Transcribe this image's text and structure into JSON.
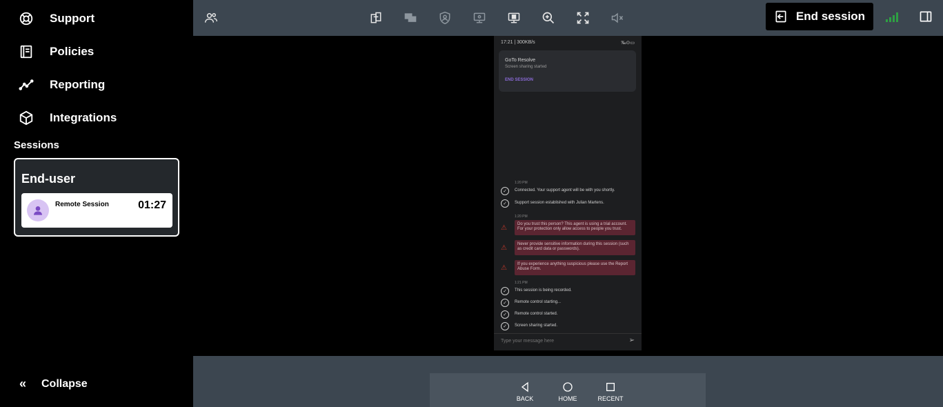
{
  "sidebar": {
    "items": [
      {
        "label": "Support",
        "icon": "lifebuoy-icon"
      },
      {
        "label": "Policies",
        "icon": "book-icon"
      },
      {
        "label": "Reporting",
        "icon": "chart-line-icon"
      },
      {
        "label": "Integrations",
        "icon": "cube-icon"
      }
    ],
    "sessions_heading": "Sessions",
    "session_card": {
      "title": "End-user",
      "name": "Remote Session",
      "time": "01:27"
    },
    "collapse_label": "Collapse",
    "collapse_icon": "«"
  },
  "toolbar": {
    "end_session_label": "End session",
    "icons": [
      "participants-icon",
      "clipboard-transfer-icon",
      "screens-icon",
      "shield-user-icon",
      "remote-view-icon",
      "remote-control-icon",
      "zoom-in-icon",
      "fullscreen-icon",
      "mute-icon"
    ]
  },
  "phone": {
    "status_left": "17:21 | 300KB/s",
    "status_right": "‰⊙▭",
    "notification": {
      "title": "GoTo Resolve",
      "subtitle": "Screen sharing started",
      "action": "END SESSION"
    },
    "chat": {
      "time1": "1:20 PM",
      "msg1": "Connected. Your support agent will be with you shortly.",
      "msg2": "Support session established with Julian Martens.",
      "time2": "1:20 PM",
      "warn1": "Do you trust this person? This agent is using a trial account. For your protection only allow access to people you trust.",
      "warn2": "Never provide sensitive information during this session (such as credit card data or passwords).",
      "warn3": "If you experience anything suspicious please use the Report Abuse Form.",
      "time3": "1:21 PM",
      "msg3": "This session is being recorded.",
      "msg4": "Remote control starting...",
      "msg5": "Remote control started.",
      "msg6": "Screen sharing started."
    },
    "input_placeholder": "Type your message here"
  },
  "android_nav": {
    "back": "BACK",
    "home": "HOME",
    "recent": "RECENT"
  },
  "colors": {
    "toolbar_bg": "#3c4650",
    "signal_green": "#2ea043",
    "warning_bg": "#5b2531"
  }
}
